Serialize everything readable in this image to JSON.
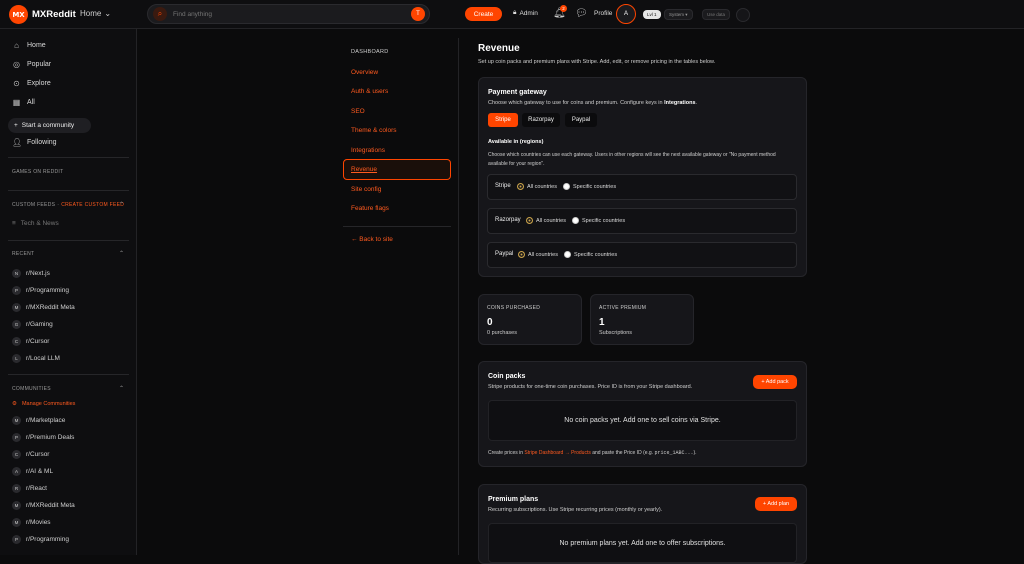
{
  "topbar": {
    "logo_text": "MX",
    "brand": "MXReddit",
    "home_label": "Home",
    "search_placeholder": "Find anything",
    "search_badge": "T",
    "create_label": "Create",
    "admin_label": "Admin",
    "notif_count": "2",
    "profile_label": "Profile",
    "avatar_letter": "A",
    "level_badge": "Lvl 1",
    "theme_label": "System ▾",
    "data_label": "Use data"
  },
  "sidebar": {
    "nav": [
      {
        "label": "Home",
        "icon": "home-icon"
      },
      {
        "label": "Popular",
        "icon": "popular-icon"
      },
      {
        "label": "Explore",
        "icon": "explore-icon"
      },
      {
        "label": "All",
        "icon": "all-icon"
      }
    ],
    "start_community": "Start a community",
    "following": "Following",
    "games_title": "GAMES ON REDDIT",
    "custom_feeds_title": "CUSTOM FEEDS",
    "create_custom_feed": "CREATE CUSTOM FEED",
    "tech_news": "Tech & News",
    "recent_title": "RECENT",
    "recent": [
      {
        "avatar": "N",
        "name": "r/Next.js"
      },
      {
        "avatar": "P",
        "name": "r/Programming"
      },
      {
        "avatar": "M",
        "name": "r/MXReddit Meta"
      },
      {
        "avatar": "G",
        "name": "r/Gaming"
      },
      {
        "avatar": "C",
        "name": "r/Cursor"
      },
      {
        "avatar": "L",
        "name": "r/Local LLM"
      }
    ],
    "communities_title": "COMMUNITIES",
    "manage_communities": "Manage Communities",
    "communities": [
      {
        "avatar": "M",
        "name": "r/Marketplace"
      },
      {
        "avatar": "P",
        "name": "r/Premium Deals"
      },
      {
        "avatar": "C",
        "name": "r/Cursor"
      },
      {
        "avatar": "A",
        "name": "r/AI & ML"
      },
      {
        "avatar": "R",
        "name": "r/React"
      },
      {
        "avatar": "M",
        "name": "r/MXReddit Meta"
      },
      {
        "avatar": "M",
        "name": "r/Movies"
      },
      {
        "avatar": "P",
        "name": "r/Programming"
      }
    ]
  },
  "admin_nav": {
    "title": "DASHBOARD",
    "items": [
      "Overview",
      "Auth & users",
      "SEO",
      "Theme & colors",
      "Integrations",
      "Revenue",
      "Site config",
      "Feature flags"
    ],
    "back": "← Back to site"
  },
  "page": {
    "title": "Revenue",
    "subtitle": "Set up coin packs and premium plans with Stripe. Add, edit, or remove pricing in the tables below."
  },
  "gateway": {
    "title": "Payment gateway",
    "desc_prefix": "Choose which gateway to use for coins and premium. Configure keys in ",
    "desc_bold": "Integrations",
    "desc_suffix": ".",
    "buttons": [
      "Stripe",
      "Razorpay",
      "Paypal"
    ],
    "regions_title": "Available in (regions)",
    "regions_desc": "Choose which countries can use each gateway. Users in other regions will see the next available gateway or \"No payment method available for your region\".",
    "rows": [
      {
        "name": "Stripe",
        "opt1": "All countries",
        "opt2": "Specific countries"
      },
      {
        "name": "Razorpay",
        "opt1": "All countries",
        "opt2": "Specific countries"
      },
      {
        "name": "Paypal",
        "opt1": "All countries",
        "opt2": "Specific countries"
      }
    ]
  },
  "stats": [
    {
      "label": "COINS PURCHASED",
      "value": "0",
      "sub": "0 purchases"
    },
    {
      "label": "ACTIVE PREMIUM",
      "value": "1",
      "sub": "Subscriptions"
    }
  ],
  "coin_packs": {
    "title": "Coin packs",
    "desc": "Stripe products for one-time coin purchases. Price ID is from your Stripe dashboard.",
    "add": "+ Add pack",
    "empty": "No coin packs yet. Add one to sell coins via Stripe.",
    "foot_prefix": "Create prices in ",
    "foot_link": "Stripe Dashboard → Products",
    "foot_mid": " and paste the Price ID (e.g. ",
    "foot_code": "price_1ABC...",
    "foot_suffix": ")."
  },
  "premium_plans": {
    "title": "Premium plans",
    "desc": "Recurring subscriptions. Use Stripe recurring prices (monthly or yearly).",
    "add": "+ Add plan",
    "empty": "No premium plans yet. Add one to offer subscriptions."
  },
  "colors": {
    "accent": "#ff4500",
    "bg": "#0b0b0c",
    "card": "#16161a"
  }
}
